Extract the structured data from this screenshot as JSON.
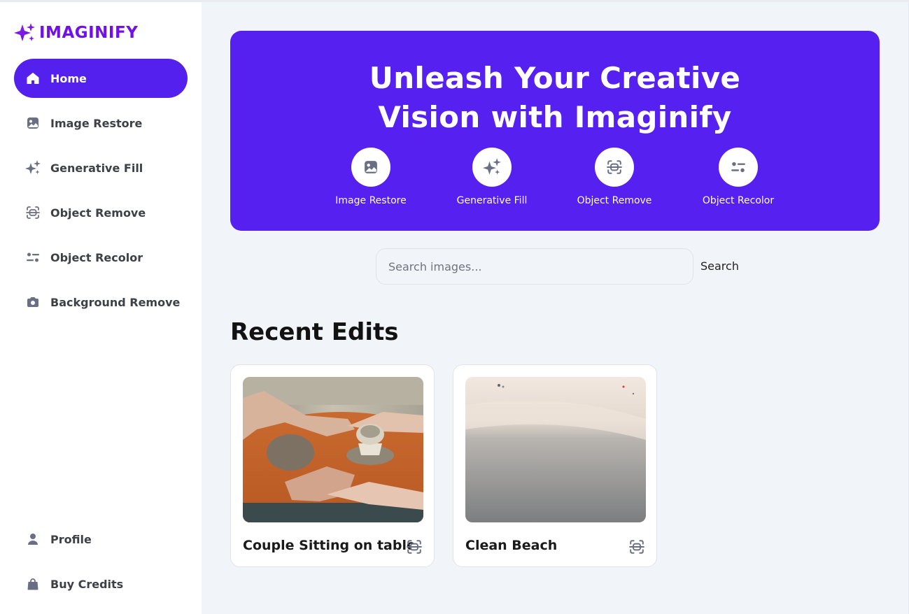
{
  "app": {
    "name": "IMAGINIFY",
    "brand_color": "#7210e8",
    "accent": "#5420ee"
  },
  "sidebar": {
    "items": [
      {
        "label": "Home",
        "icon": "home-icon",
        "active": true
      },
      {
        "label": "Image Restore",
        "icon": "image-icon"
      },
      {
        "label": "Generative Fill",
        "icon": "stars-icon"
      },
      {
        "label": "Object Remove",
        "icon": "scan-icon"
      },
      {
        "label": "Object Recolor",
        "icon": "filter-icon"
      },
      {
        "label": "Background Remove",
        "icon": "camera-icon"
      }
    ],
    "bottom": [
      {
        "label": "Profile",
        "icon": "user-icon"
      },
      {
        "label": "Buy Credits",
        "icon": "bag-icon"
      }
    ]
  },
  "hero": {
    "title_line1": "Unleash Your Creative",
    "title_line2": "Vision with Imaginify",
    "features": [
      {
        "label": "Image Restore",
        "icon": "image-icon"
      },
      {
        "label": "Generative Fill",
        "icon": "stars-icon"
      },
      {
        "label": "Object Remove",
        "icon": "scan-icon"
      },
      {
        "label": "Object Recolor",
        "icon": "filter-icon"
      }
    ]
  },
  "search": {
    "placeholder": "Search images...",
    "button_label": "Search"
  },
  "recent": {
    "title": "Recent Edits",
    "items": [
      {
        "title": "Couple Sitting on table",
        "icon": "scan-icon"
      },
      {
        "title": "Clean Beach",
        "icon": "scan-icon"
      }
    ]
  }
}
